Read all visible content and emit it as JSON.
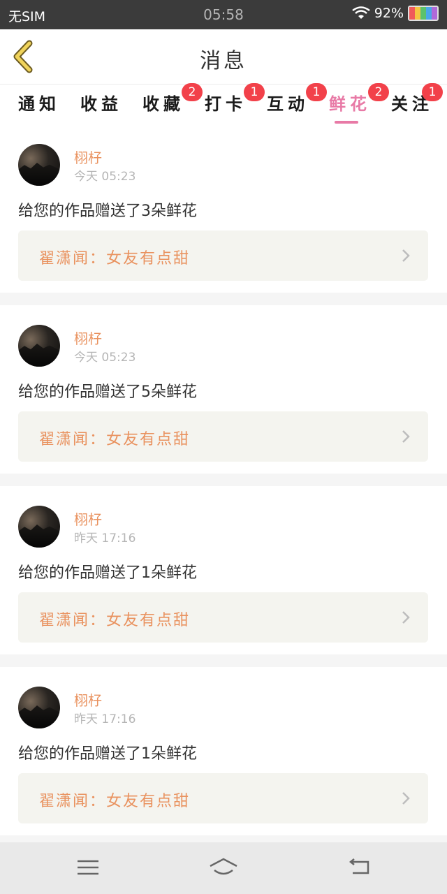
{
  "status": {
    "carrier": "无SIM",
    "time": "05:58",
    "battery": "92%",
    "battery_colors": [
      "#f05a5a",
      "#f5c542",
      "#5bc26b",
      "#4aa7e8",
      "#b06ad8"
    ]
  },
  "header": {
    "title": "消息",
    "back_icon": "chevron-left-icon"
  },
  "tabs": [
    {
      "label": "通知",
      "badge": ""
    },
    {
      "label": "收益",
      "badge": ""
    },
    {
      "label": "收藏",
      "badge": "2"
    },
    {
      "label": "打卡",
      "badge": "1"
    },
    {
      "label": "互动",
      "badge": "1"
    },
    {
      "label": "鲜花",
      "badge": "2",
      "active": true
    },
    {
      "label": "关注",
      "badge": "1"
    }
  ],
  "messages": [
    {
      "user": "栩杍",
      "time": "今天 05:23",
      "text": "给您的作品赠送了3朵鲜花",
      "work": "翟潇闻：女友有点甜"
    },
    {
      "user": "栩杍",
      "time": "今天 05:23",
      "text": "给您的作品赠送了5朵鲜花",
      "work": "翟潇闻：女友有点甜"
    },
    {
      "user": "栩杍",
      "time": "昨天 17:16",
      "text": "给您的作品赠送了1朵鲜花",
      "work": "翟潇闻：女友有点甜"
    },
    {
      "user": "栩杍",
      "time": "昨天 17:16",
      "text": "给您的作品赠送了1朵鲜花",
      "work": "翟潇闻：女友有点甜"
    }
  ],
  "colors": {
    "accent": "#e87aa6",
    "username": "#e9925f",
    "badge": "#f2414a",
    "back": "#f0d35a"
  },
  "nav_icons": [
    "menu-icon",
    "home-icon",
    "back-arrow-icon"
  ]
}
